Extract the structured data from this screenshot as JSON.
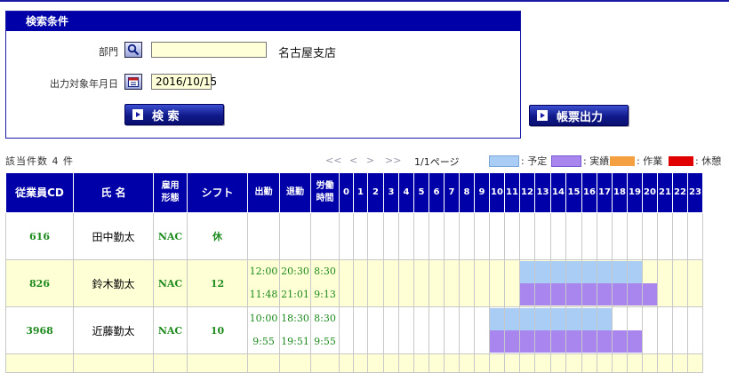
{
  "search": {
    "title": "検索条件",
    "dept_label": "部門",
    "dept_value": "",
    "dept_name": "名古屋支店",
    "date_label": "出力対象年月日",
    "date_value": "2016/10/15",
    "search_button": "検 索",
    "report_button": "帳票出力"
  },
  "result": {
    "count": "該当件数 4 件",
    "pager": {
      "first": "<<",
      "prev": "<",
      "next": ">",
      "last": ">>",
      "info": "1/1ページ"
    }
  },
  "legend": [
    {
      "label": ": 予定",
      "color": "#a9cdf5"
    },
    {
      "label": ": 実績",
      "color": "#a986ee"
    },
    {
      "label": ": 作業",
      "color": "#f4a040"
    },
    {
      "label": ": 休憩",
      "color": "#e00000"
    }
  ],
  "headers": {
    "emp_cd": "従業員CD",
    "name": "氏 名",
    "emp_type_1": "雇用",
    "emp_type_2": "形態",
    "shift": "シフト",
    "in": "出勤",
    "out": "退勤",
    "work_1": "労働",
    "work_2": "時間",
    "hours": [
      "0",
      "1",
      "2",
      "3",
      "4",
      "5",
      "6",
      "7",
      "8",
      "9",
      "10",
      "11",
      "12",
      "13",
      "14",
      "15",
      "16",
      "17",
      "18",
      "19",
      "20",
      "21",
      "22",
      "23"
    ]
  },
  "rows": [
    {
      "cd": "616",
      "name": "田中勤太",
      "type": "NAC",
      "shift": "休",
      "plan_in": "",
      "plan_out": "",
      "plan_work": "",
      "act_in": "",
      "act_out": "",
      "act_work": "",
      "plan_hours": [],
      "act_hours": []
    },
    {
      "cd": "826",
      "name": "鈴木勤太",
      "type": "NAC",
      "shift": "12",
      "plan_in": "12:00",
      "plan_out": "20:30",
      "plan_work": "8:30",
      "act_in": "11:48",
      "act_out": "21:01",
      "act_work": "9:13",
      "plan_hours": [
        12,
        13,
        14,
        15,
        16,
        17,
        18,
        19
      ],
      "act_hours": [
        12,
        13,
        14,
        15,
        16,
        17,
        18,
        19,
        20
      ]
    },
    {
      "cd": "3968",
      "name": "近藤勤太",
      "type": "NAC",
      "shift": "10",
      "plan_in": "10:00",
      "plan_out": "18:30",
      "plan_work": "8:30",
      "act_in": "9:55",
      "act_out": "19:51",
      "act_work": "9:55",
      "plan_hours": [
        10,
        11,
        12,
        13,
        14,
        15,
        16,
        17
      ],
      "act_hours": [
        10,
        11,
        12,
        13,
        14,
        15,
        16,
        17,
        18,
        19
      ]
    }
  ]
}
